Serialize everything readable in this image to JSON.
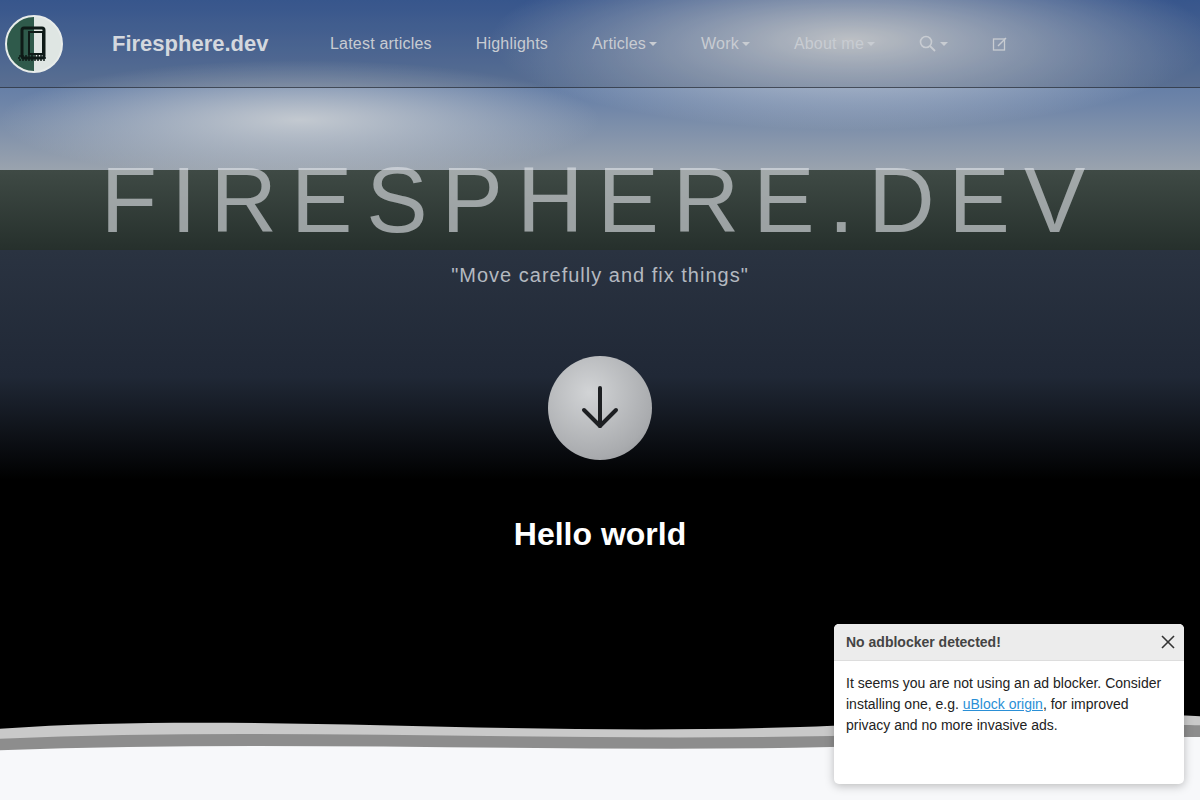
{
  "header": {
    "brand": "Firesphere.dev",
    "nav": [
      {
        "label": "Latest articles",
        "dropdown": false
      },
      {
        "label": "Highlights",
        "dropdown": false
      },
      {
        "label": "Articles",
        "dropdown": true
      },
      {
        "label": "Work",
        "dropdown": true
      },
      {
        "label": "About me",
        "dropdown": true
      }
    ],
    "search": {
      "dropdown": true
    }
  },
  "hero": {
    "title": "FIRESPHERE.DEV",
    "tagline": "\"Move carefully and fix things\""
  },
  "content": {
    "heading": "Hello world"
  },
  "toast": {
    "title": "No adblocker detected!",
    "text_before": "It seems you are not using an ad blocker. Consider installing one, e.g. ",
    "link": "uBlock origin",
    "text_after": ", for improved privacy and no more invasive ads."
  }
}
